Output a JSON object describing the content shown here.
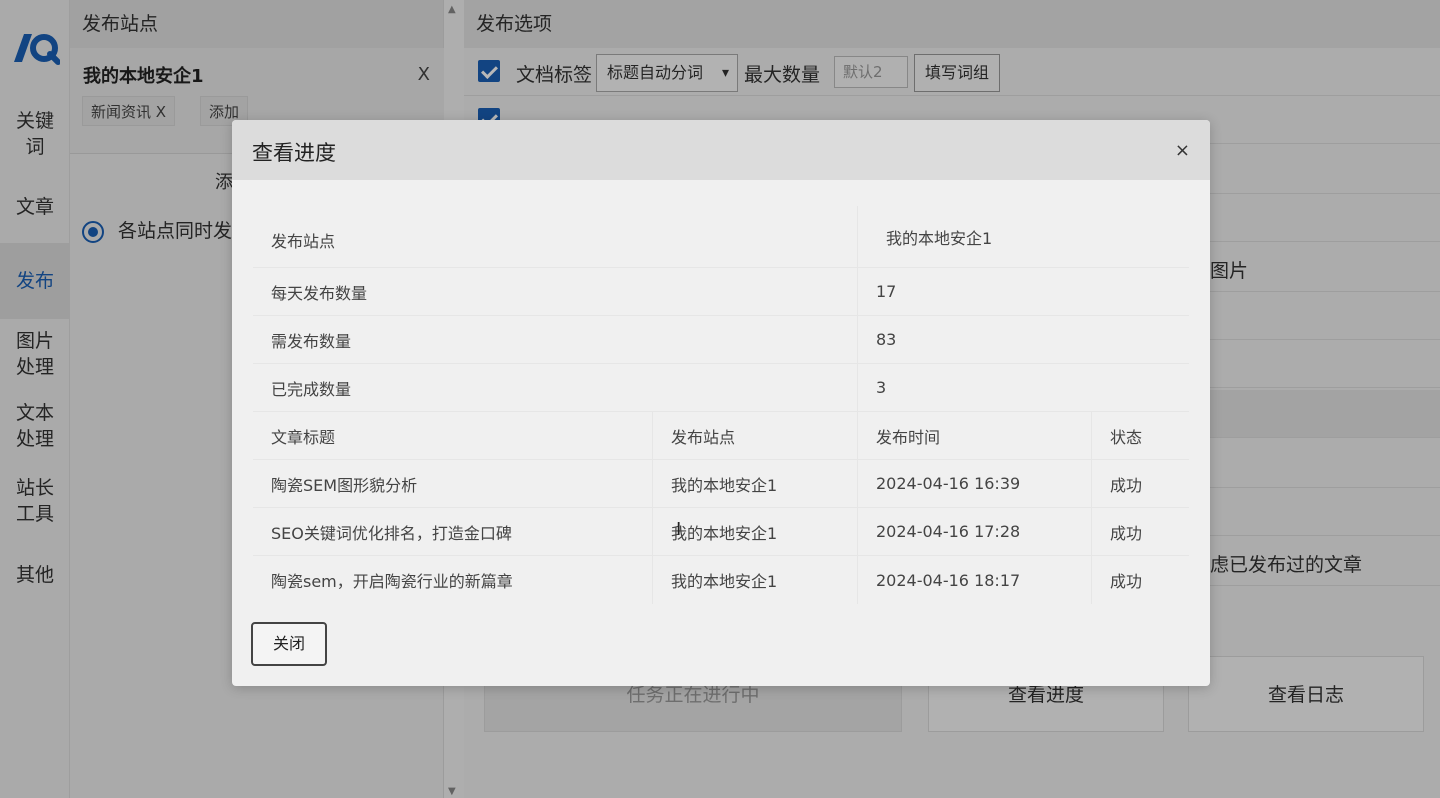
{
  "nav": {
    "items": [
      {
        "label": "关键\n词"
      },
      {
        "label": "文章"
      },
      {
        "label": "发布"
      },
      {
        "label": "图片\n处理"
      },
      {
        "label": "文本\n处理"
      },
      {
        "label": "站长\n工具"
      },
      {
        "label": "其他"
      }
    ],
    "active_index": 2,
    "accent_color": "#1a5fb4"
  },
  "site_panel": {
    "title": "发布站点",
    "site": {
      "name": "我的本地安企1",
      "remove": "X"
    },
    "tags": [
      {
        "label": "新闻资讯 X"
      },
      {
        "label": "添加"
      }
    ],
    "add_partial": "添",
    "radio_partial": "各站点同时发"
  },
  "options": {
    "title": "发布选项",
    "row1": {
      "label": "文档标签",
      "select": "标题自动分词",
      "max_label": "最大数量",
      "max_placeholder": "默认2",
      "button": "填写词组"
    },
    "partial_image": "图片",
    "partial_filter": "虑已发布过的文章",
    "bottom": {
      "running": "任务正在进行中",
      "progress": "查看进度",
      "log": "查看日志"
    }
  },
  "modal": {
    "title": "查看进度",
    "close_x": "×",
    "summary": [
      {
        "label": "发布站点",
        "value": "我的本地安企1"
      },
      {
        "label": "每天发布数量",
        "value": "17"
      },
      {
        "label": "需发布数量",
        "value": "83"
      },
      {
        "label": "已完成数量",
        "value": "3"
      }
    ],
    "columns": [
      "文章标题",
      "发布站点",
      "发布时间",
      "状态"
    ],
    "rows": [
      {
        "title": "陶瓷SEM图形貌分析",
        "site": "我的本地安企1",
        "time": "2024-04-16 16:39",
        "status": "成功"
      },
      {
        "title": "SEO关键词优化排名，打造金口碑",
        "site": "我的本地安企1",
        "time": "2024-04-16 17:28",
        "status": "成功"
      },
      {
        "title": "陶瓷sem，开启陶瓷行业的新篇章",
        "site": "我的本地安企1",
        "time": "2024-04-16 18:17",
        "status": "成功"
      }
    ],
    "close_button": "关闭"
  }
}
